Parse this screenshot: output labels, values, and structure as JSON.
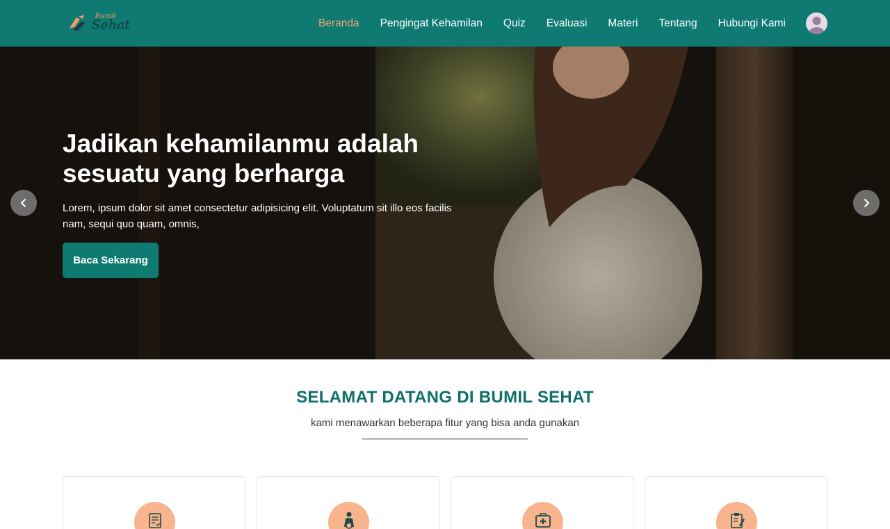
{
  "brand": {
    "logo_small": "Bumil",
    "logo_big": "Sehat"
  },
  "nav": {
    "items": [
      {
        "label": "Beranda",
        "active": true
      },
      {
        "label": "Pengingat Kehamilan",
        "active": false
      },
      {
        "label": "Quiz",
        "active": false
      },
      {
        "label": "Evaluasi",
        "active": false
      },
      {
        "label": "Materi",
        "active": false
      },
      {
        "label": "Tentang",
        "active": false
      },
      {
        "label": "Hubungi Kami",
        "active": false
      }
    ]
  },
  "hero": {
    "title": "Jadikan kehamilanmu adalah sesuatu yang berharga",
    "description": "Lorem, ipsum dolor sit amet consectetur adipisicing elit. Voluptatum sit illo eos facilis nam, sequi quo quam, omnis,",
    "button_label": "Baca Sekarang",
    "prev_icon": "chevron-left-icon",
    "next_icon": "chevron-right-icon"
  },
  "welcome": {
    "title": "SELAMAT DATANG DI BUMIL SEHAT",
    "subtitle": "kami menawarkan beberapa fitur yang bisa anda gunakan"
  },
  "features": {
    "cards": [
      {
        "icon": "document-check-icon"
      },
      {
        "icon": "pregnant-woman-icon"
      },
      {
        "icon": "medical-box-icon"
      },
      {
        "icon": "clipboard-edit-icon"
      }
    ]
  },
  "colors": {
    "primary": "#0e7a72",
    "accent": "#f2a36f",
    "icon_bg": "#f8b48c",
    "heading": "#0e6f69"
  }
}
